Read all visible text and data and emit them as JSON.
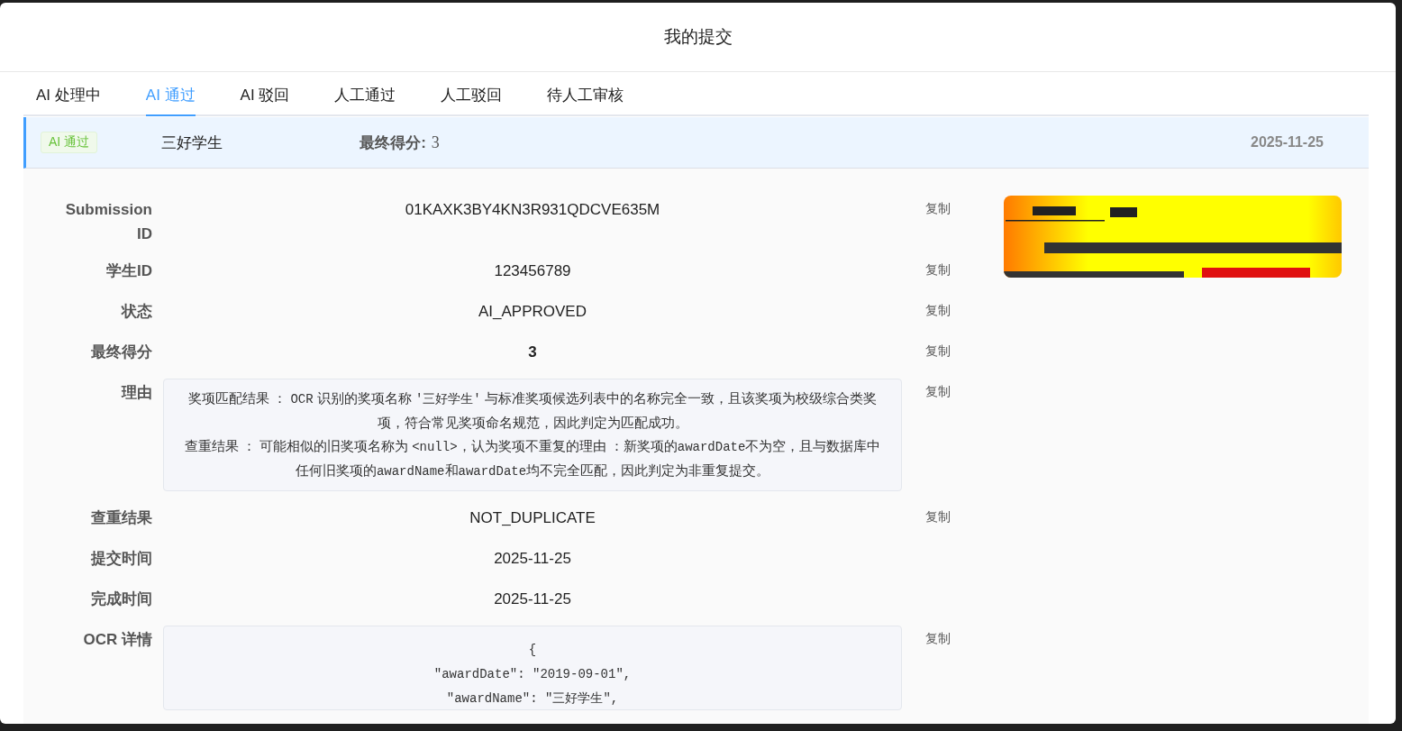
{
  "dialog": {
    "title": "我的提交"
  },
  "tabs": [
    {
      "label": "AI 处理中",
      "selected": false
    },
    {
      "label": "AI 通过",
      "selected": true
    },
    {
      "label": "AI 驳回",
      "selected": false
    },
    {
      "label": "人工通过",
      "selected": false
    },
    {
      "label": "人工驳回",
      "selected": false
    },
    {
      "label": "待人工审核",
      "selected": false
    }
  ],
  "submission": {
    "status_tag": "AI 通过",
    "award": "三好学生",
    "score_label": "最终得分:",
    "score": "3",
    "date": "2025-11-25",
    "fields": [
      {
        "kind": "text",
        "label": "Submission ID",
        "value": "01KAXK3BY4KN3R931QDCVE635M",
        "copy": "复制"
      },
      {
        "kind": "text",
        "label": "学生ID",
        "value": "123456789",
        "copy": "复制"
      },
      {
        "kind": "text",
        "label": "状态",
        "value": "AI_APPROVED",
        "copy": "复制"
      },
      {
        "kind": "strong",
        "label": "最终得分",
        "value": "3",
        "copy": "复制"
      },
      {
        "kind": "reason",
        "label": "理由",
        "copy": "复制",
        "paragraphs": [
          [
            {
              "text": "奖项匹配结果 ： ",
              "code": false
            },
            {
              "text": "OCR",
              "code": true
            },
            {
              "text": " 识别的奖项名称 ",
              "code": false
            },
            {
              "text": "'三好学生'",
              "code": true
            },
            {
              "text": " 与标准奖项候选列表中的名称完全一致，且该奖项为校级综合类奖项，符合常见奖项命名规范，因此判定为匹配成功。",
              "code": false
            }
          ],
          [
            {
              "text": "查重结果 ： 可能相似的旧奖项名称为 ",
              "code": false
            },
            {
              "text": "<null>",
              "code": true
            },
            {
              "text": "，认为奖项不重复的理由 ：新奖项的",
              "code": false
            },
            {
              "text": "awardDate",
              "code": true
            },
            {
              "text": "不为空，且与数据库中任何旧奖项的",
              "code": false
            },
            {
              "text": "awardName",
              "code": true
            },
            {
              "text": "和",
              "code": false
            },
            {
              "text": "awardDate",
              "code": true
            },
            {
              "text": "均不完全匹配，因此判定为非重复提交。",
              "code": false
            }
          ]
        ]
      },
      {
        "kind": "text",
        "label": "查重结果",
        "value": "NOT_DUPLICATE",
        "copy": "复制"
      },
      {
        "kind": "text",
        "label": "提交时间",
        "value": "2025-11-25"
      },
      {
        "kind": "text",
        "label": "完成时间",
        "value": "2025-11-25"
      },
      {
        "kind": "code",
        "label": "OCR 详情",
        "copy": "复制",
        "lines": [
          "{",
          "\"awardDate\": \"2019-09-01\",",
          "\"awardName\": \"三好学生\","
        ]
      }
    ]
  }
}
